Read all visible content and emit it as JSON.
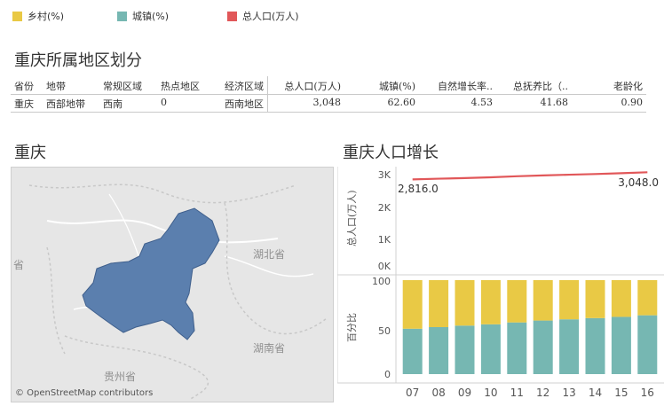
{
  "legend": [
    {
      "label": "乡村(%)",
      "color": "#e9c945"
    },
    {
      "label": "城镇(%)",
      "color": "#76b7b2"
    },
    {
      "label": "总人口(万人)",
      "color": "#e15759"
    }
  ],
  "section_title": "重庆所属地区划分",
  "table": {
    "columns": [
      "省份",
      "地带",
      "常规区域",
      "热点地区",
      "经济区域",
      "总人口(万人)",
      "城镇(%)",
      "自然增长率..",
      "总抚养比（..",
      "老龄化"
    ],
    "row": [
      "重庆",
      "西部地带",
      "西南",
      "0",
      "西南地区",
      "3,048",
      "62.60",
      "4.53",
      "41.68",
      "0.90"
    ]
  },
  "map": {
    "title": "重庆",
    "labels": {
      "hubei": "湖北省",
      "hunan": "湖南省",
      "guizhou": "贵州省",
      "left": "省"
    },
    "attribution": "© OpenStreetMap contributors"
  },
  "chart": {
    "title": "重庆人口增长",
    "top_axis_label": "总人口(万人)",
    "bottom_axis_label": "百分比",
    "top_ticks": [
      "3K",
      "2K",
      "1K",
      "0K"
    ],
    "bottom_ticks": [
      "100",
      "50",
      "0"
    ],
    "first_label": "2,816.0",
    "last_label": "3,048.0"
  },
  "chart_data": [
    {
      "type": "line",
      "x": [
        "07",
        "08",
        "09",
        "10",
        "11",
        "12",
        "13",
        "14",
        "15",
        "16"
      ],
      "series": [
        {
          "name": "总人口(万人)",
          "values": [
            2816,
            2839,
            2859,
            2885,
            2919,
            2945,
            2970,
            2991,
            3017,
            3048
          ],
          "color": "#e15759"
        }
      ],
      "ylabel": "总人口(万人)",
      "ylim": [
        0,
        3000
      ]
    },
    {
      "type": "bar",
      "stacked": true,
      "categories": [
        "07",
        "08",
        "09",
        "10",
        "11",
        "12",
        "13",
        "14",
        "15",
        "16"
      ],
      "series": [
        {
          "name": "城镇(%)",
          "values": [
            48.3,
            50.0,
            51.6,
            53.0,
            55.0,
            57.0,
            58.3,
            59.6,
            60.9,
            62.6
          ],
          "color": "#76b7b2"
        },
        {
          "name": "乡村(%)",
          "values": [
            51.7,
            50.0,
            48.4,
            47.0,
            45.0,
            43.0,
            41.7,
            40.4,
            39.1,
            37.4
          ],
          "color": "#e9c945"
        }
      ],
      "ylabel": "百分比",
      "ylim": [
        0,
        100
      ]
    }
  ]
}
